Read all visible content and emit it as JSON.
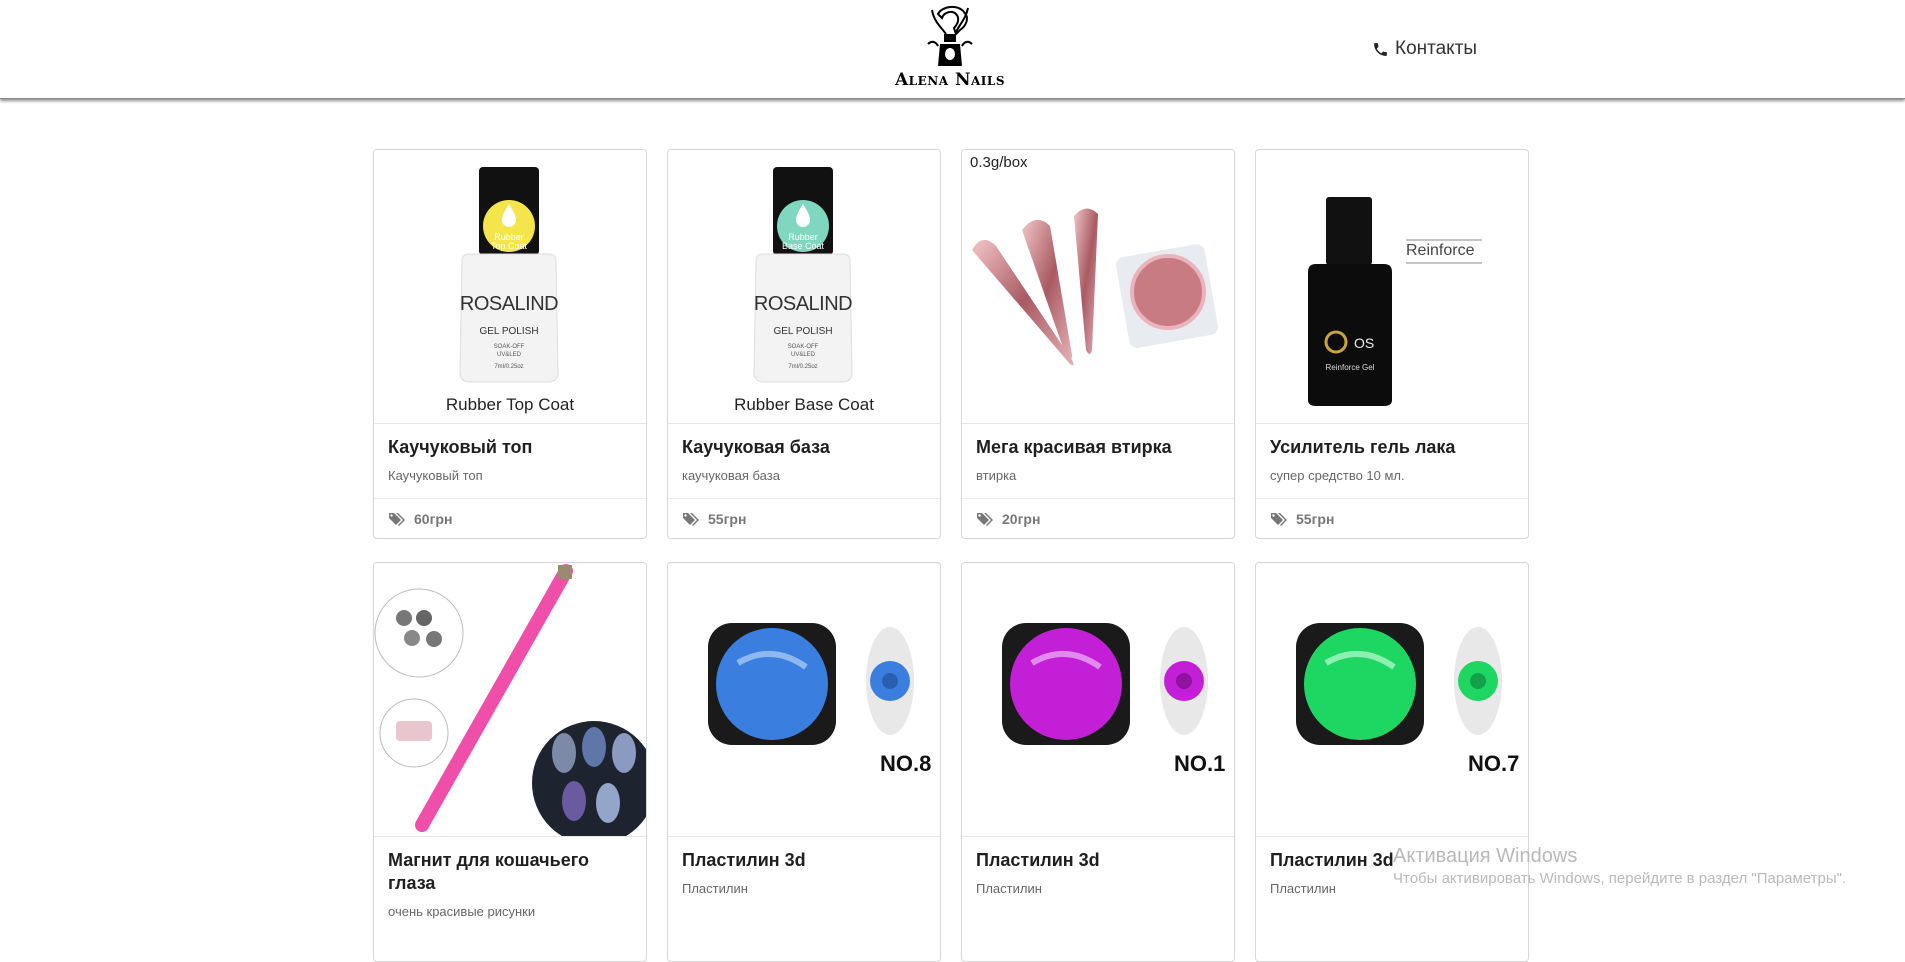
{
  "header": {
    "logo_text": "Alena Nails",
    "contacts_label": "Контакты"
  },
  "products": [
    {
      "title": "Каучуковый топ",
      "desc": "Каучуковый топ",
      "price": "60грн",
      "image_caption": "Rubber Top Coat",
      "bottle_text": "ROSALIND",
      "bottle_sub": "GEL POLISH",
      "label_text": "Rubber Top Coat"
    },
    {
      "title": "Каучуковая база",
      "desc": "каучуковая база",
      "price": "55грн",
      "image_caption": "Rubber Base Coat",
      "bottle_text": "ROSALIND",
      "bottle_sub": "GEL POLISH",
      "label_text": "Rubber Base Coat"
    },
    {
      "title": "Мега красивая втирка",
      "desc": "втирка",
      "price": "20грн",
      "image_caption": "0.3g/box"
    },
    {
      "title": "Усилитель гель лака",
      "desc": "супер средство 10 мл.",
      "price": "55грн",
      "image_caption": "Reinforce",
      "bottle_text": "OS",
      "bottle_sub": "Reinforce Gel"
    },
    {
      "title": "Магнит для кошачьего глаза",
      "desc": "очень красивые рисунки"
    },
    {
      "title": "Пластилин 3d",
      "desc": "Пластилин",
      "image_caption": "NO.8",
      "color": "#3a7fe0"
    },
    {
      "title": "Пластилин 3d",
      "desc": "Пластилин",
      "image_caption": "NO.1",
      "color": "#c21fd6"
    },
    {
      "title": "Пластилин 3d",
      "desc": "Пластилин",
      "image_caption": "NO.7",
      "color": "#1ed763"
    }
  ],
  "watermark": {
    "title": "Активация Windows",
    "subtitle": "Чтобы активировать Windows, перейдите в раздел \"Параметры\"."
  }
}
